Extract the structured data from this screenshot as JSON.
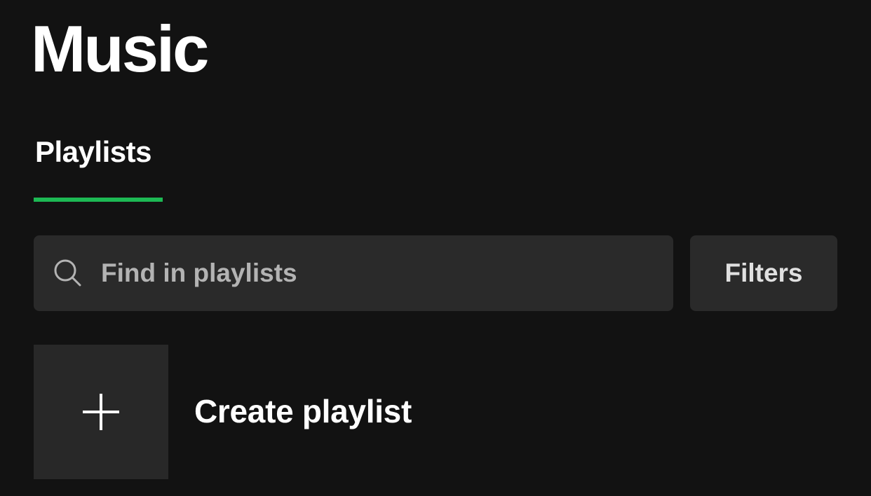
{
  "header": {
    "title": "Music"
  },
  "tabs": [
    {
      "label": "Playlists",
      "active": true
    }
  ],
  "search": {
    "placeholder": "Find in playlists",
    "value": "",
    "icon": "search-icon"
  },
  "filters": {
    "label": "Filters"
  },
  "create_playlist": {
    "label": "Create playlist",
    "icon": "plus-icon"
  },
  "colors": {
    "background": "#121212",
    "surface": "#2a2a2a",
    "accent": "#1db954",
    "text_primary": "#ffffff",
    "text_secondary": "#b3b3b3"
  }
}
